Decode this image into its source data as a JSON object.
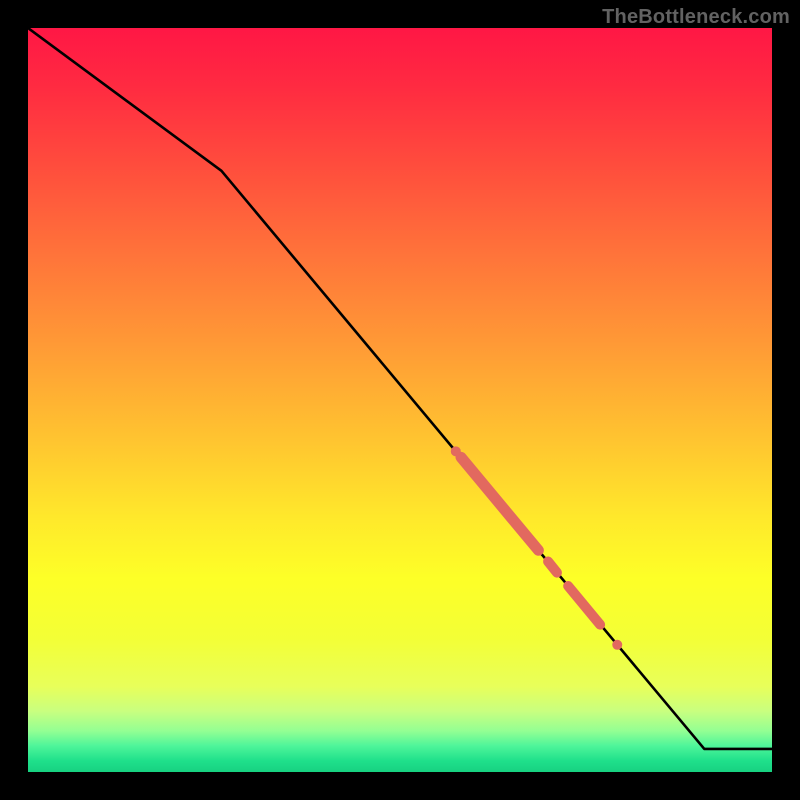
{
  "watermark": "TheBottleneck.com",
  "colors": {
    "bg": "#000000",
    "line": "#000000",
    "marker": "#e2695f",
    "gradient_stops": [
      {
        "offset": 0.0,
        "color": "#ff1745"
      },
      {
        "offset": 0.08,
        "color": "#ff2b41"
      },
      {
        "offset": 0.18,
        "color": "#ff4b3d"
      },
      {
        "offset": 0.3,
        "color": "#ff723a"
      },
      {
        "offset": 0.42,
        "color": "#ff9836"
      },
      {
        "offset": 0.55,
        "color": "#ffc330"
      },
      {
        "offset": 0.66,
        "color": "#ffe92b"
      },
      {
        "offset": 0.74,
        "color": "#fdff27"
      },
      {
        "offset": 0.82,
        "color": "#f3ff36"
      },
      {
        "offset": 0.885,
        "color": "#e8ff5a"
      },
      {
        "offset": 0.918,
        "color": "#c9ff7f"
      },
      {
        "offset": 0.945,
        "color": "#93ff93"
      },
      {
        "offset": 0.965,
        "color": "#4ef59a"
      },
      {
        "offset": 0.985,
        "color": "#1fe08b"
      },
      {
        "offset": 1.0,
        "color": "#17d181"
      }
    ]
  },
  "chart_data": {
    "type": "line",
    "title": "",
    "xlabel": "",
    "ylabel": "",
    "xlim": [
      0,
      100
    ],
    "ylim": [
      0,
      100
    ],
    "grid": false,
    "series": [
      {
        "name": "curve",
        "x": [
          0.0,
          26.0,
          90.9,
          100.0
        ],
        "y": [
          100.0,
          80.8,
          3.1,
          3.1
        ]
      }
    ],
    "bold_segments": [
      {
        "x0": 58.2,
        "y0": 42.3,
        "x1": 68.6,
        "y1": 29.8,
        "width": 11
      },
      {
        "x0": 69.9,
        "y0": 28.3,
        "x1": 71.1,
        "y1": 26.8,
        "width": 10
      },
      {
        "x0": 72.6,
        "y0": 25.0,
        "x1": 76.9,
        "y1": 19.8,
        "width": 10
      }
    ],
    "bold_points": [
      {
        "x": 57.5,
        "y": 43.1,
        "r": 5
      },
      {
        "x": 79.2,
        "y": 17.1,
        "r": 5
      }
    ]
  }
}
